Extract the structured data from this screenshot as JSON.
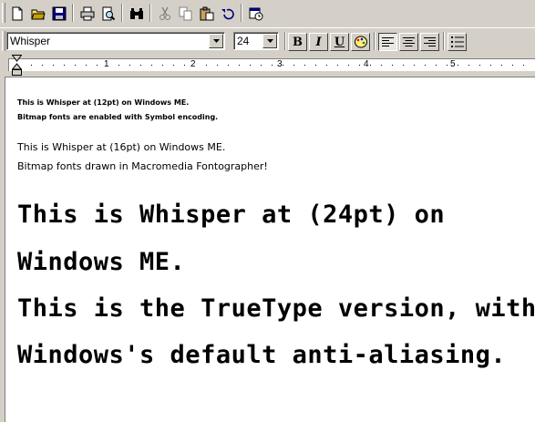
{
  "toolbar": {
    "font_name": "Whisper",
    "font_size": "24",
    "buttons": [
      "new",
      "open",
      "save",
      "print",
      "print-preview",
      "find",
      "cut",
      "copy",
      "paste",
      "undo",
      "insert-date-time"
    ],
    "format_buttons": {
      "bold": "B",
      "italic": "I",
      "underline": "U"
    }
  },
  "ruler": {
    "numbers": [
      "1",
      "2",
      "3",
      "4",
      "5"
    ]
  },
  "document": {
    "lines": [
      "This is Whisper at (12pt) on Windows ME.",
      "Bitmap fonts are enabled with Symbol encoding.",
      "This is Whisper at (16pt) on Windows ME.",
      "Bitmap fonts drawn in Macromedia Fontographer!",
      "This is Whisper at (24pt) on",
      "Windows ME.",
      "This is the TrueType version, with",
      "Windows's default anti-aliasing."
    ]
  }
}
